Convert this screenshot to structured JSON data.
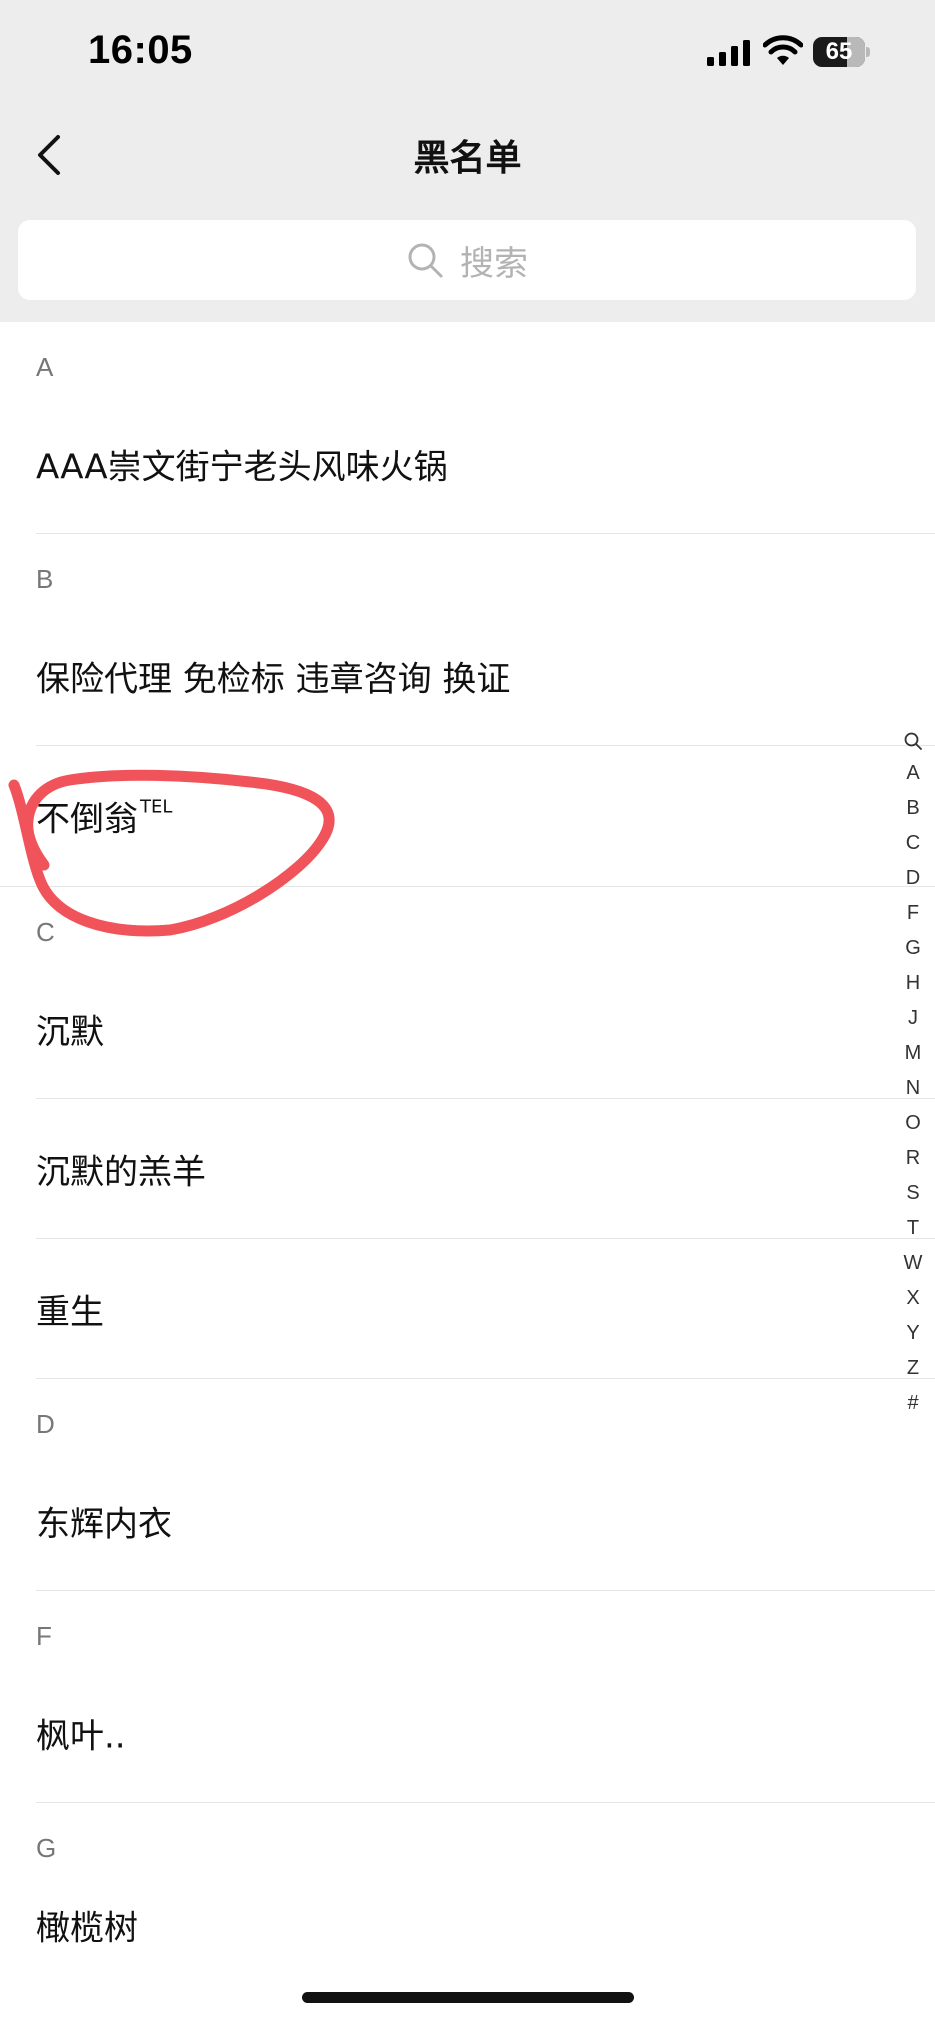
{
  "status_bar": {
    "time": "16:05",
    "battery": "65",
    "icons": [
      "signal-icon",
      "wifi-icon",
      "battery-icon"
    ]
  },
  "nav": {
    "title": "黑名单",
    "back_icon": "chevron-left-icon"
  },
  "search": {
    "placeholder": "搜索",
    "icon": "search-icon"
  },
  "sections": [
    {
      "letter": "A",
      "contacts": [
        {
          "name": "AAA崇文街宁老头风味火锅"
        }
      ]
    },
    {
      "letter": "B",
      "contacts": [
        {
          "name": "保险代理 免检标 违章咨询 换证"
        },
        {
          "name": "不倒翁",
          "suffix": "TEL"
        }
      ]
    },
    {
      "letter": "C",
      "contacts": [
        {
          "name": "沉默"
        },
        {
          "name": "沉默的羔羊"
        },
        {
          "name": "重生"
        }
      ]
    },
    {
      "letter": "D",
      "contacts": [
        {
          "name": "东辉内衣"
        }
      ]
    },
    {
      "letter": "F",
      "contacts": [
        {
          "name": "枫叶.."
        }
      ]
    },
    {
      "letter": "G",
      "contacts": [
        {
          "name": "橄榄树"
        }
      ]
    }
  ],
  "index_bar": [
    "A",
    "B",
    "C",
    "D",
    "F",
    "G",
    "H",
    "J",
    "M",
    "N",
    "O",
    "R",
    "S",
    "T",
    "W",
    "X",
    "Y",
    "Z",
    "#"
  ],
  "colors": {
    "header_bg": "#ededed",
    "annotation": "#f0545a",
    "section_letter": "#777777"
  }
}
